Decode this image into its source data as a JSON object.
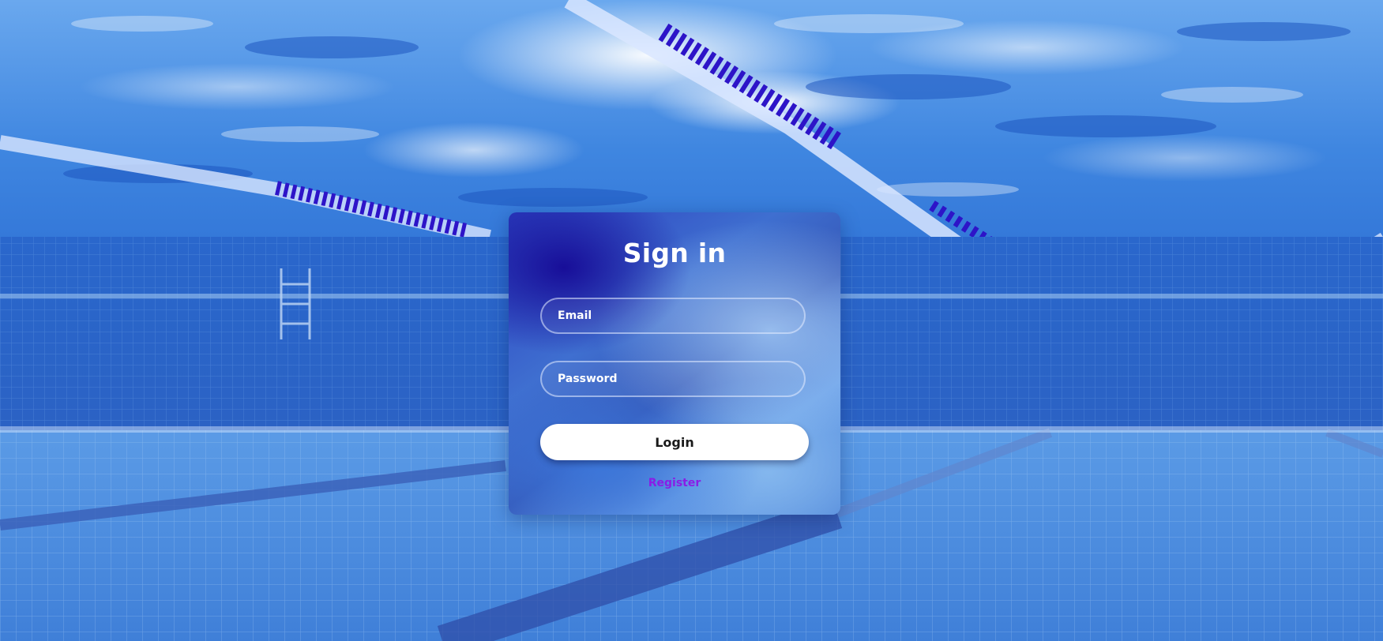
{
  "login": {
    "title": "Sign in",
    "email_placeholder": "Email",
    "password_placeholder": "Password",
    "login_label": "Login",
    "register_label": "Register"
  },
  "colors": {
    "pool_blue": "#2f6fd6",
    "button_bg": "#ffffff",
    "register_link": "#8a1de6",
    "text_on_card": "#ffffff"
  }
}
